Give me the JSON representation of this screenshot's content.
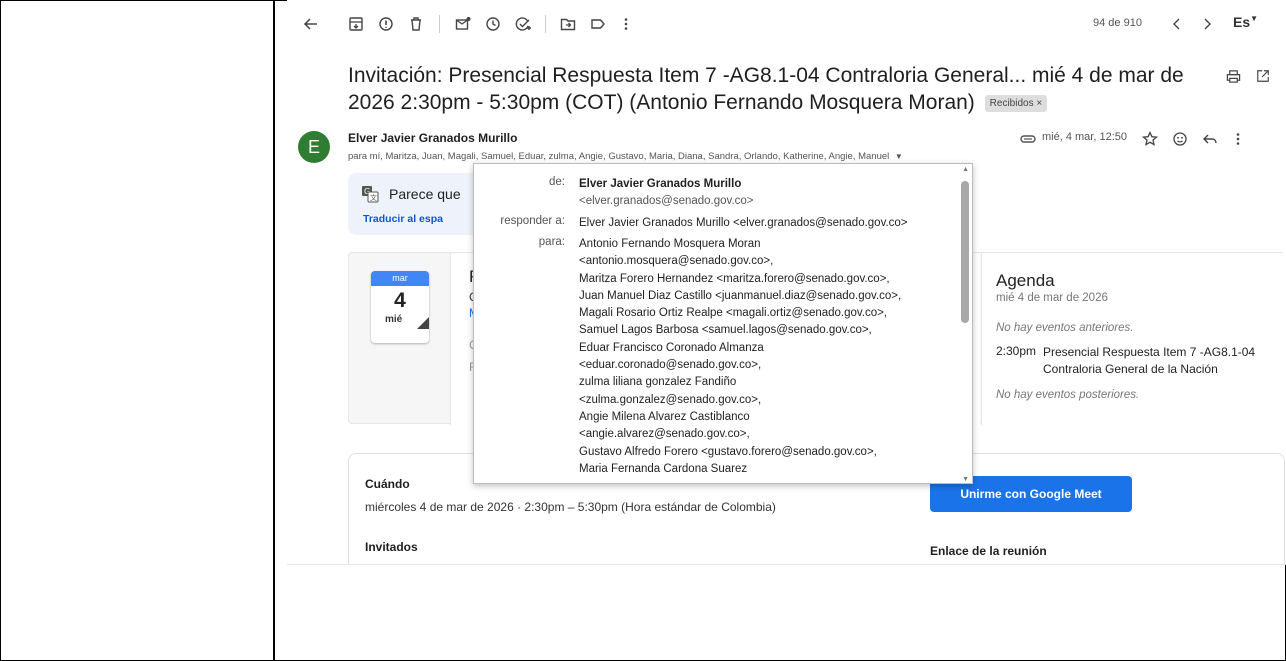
{
  "toolbar": {
    "pager": "94 de 910",
    "lang": "Es"
  },
  "subject": {
    "text": "Invitación: Presencial Respuesta Item 7 -AG8.1-04 Contraloria General... mié 4 de mar de 2026 2:30pm - 5:30pm (COT) (Antonio Fernando Mosquera Moran)",
    "label": "Recibidos ×"
  },
  "sender": {
    "avatar_letter": "E",
    "name": "Elver Javier Granados Murillo",
    "recipients": "para mí, Maritza, Juan, Magali, Samuel, Eduar, zulma, Angie, Gustavo, Maria, Diana, Sandra, Orlando, Katherine, Angie, Manuel",
    "date": "mié, 4 mar, 12:50"
  },
  "translate": {
    "text": "Parece que",
    "link": "Traducir al espa"
  },
  "invite": {
    "month": "mar",
    "day": "4",
    "weekday": "mié",
    "mid_snips": [
      "P",
      "C",
      "M",
      "C",
      "F"
    ],
    "agenda_title": "Agenda",
    "agenda_date": "mié 4 de mar de 2026",
    "no_prev": "No hay eventos anteriores.",
    "event_time": "2:30pm",
    "event_title": "Presencial Respuesta Item 7 -AG8.1-04 Contraloria General de la Nación",
    "no_next": "No hay eventos posteriores."
  },
  "details": {
    "when_label": "Cuándo",
    "when_value": "miércoles 4 de mar de 2026 · 2:30pm – 5:30pm (Hora estándar de Colombia)",
    "guests_label": "Invitados",
    "meet_button": "Unirme con Google Meet",
    "link_label": "Enlace de la reunión"
  },
  "popup": {
    "from_label": "de:",
    "from_name": "Elver Javier Granados Murillo",
    "from_email": "<elver.granados@senado.gov.co>",
    "reply_label": "responder a:",
    "reply_value": "Elver Javier Granados Murillo <elver.granados@senado.gov.co>",
    "to_label": "para:",
    "to_lines": [
      "Antonio Fernando Mosquera Moran",
      "<antonio.mosquera@senado.gov.co>,",
      "Maritza Forero Hernandez <maritza.forero@senado.gov.co>,",
      "Juan Manuel Diaz Castillo <juanmanuel.diaz@senado.gov.co>,",
      "Magali Rosario Ortiz Realpe <magali.ortiz@senado.gov.co>,",
      "Samuel Lagos Barbosa <samuel.lagos@senado.gov.co>,",
      "Eduar Francisco Coronado Almanza",
      "<eduar.coronado@senado.gov.co>,",
      "zulma liliana gonzalez Fandiño",
      "<zulma.gonzalez@senado.gov.co>,",
      "Angie Milena Alvarez Castiblanco",
      "<angie.alvarez@senado.gov.co>,",
      "Gustavo Alfredo Forero <gustavo.forero@senado.gov.co>,",
      "Maria Fernanda Cardona Suarez"
    ]
  }
}
